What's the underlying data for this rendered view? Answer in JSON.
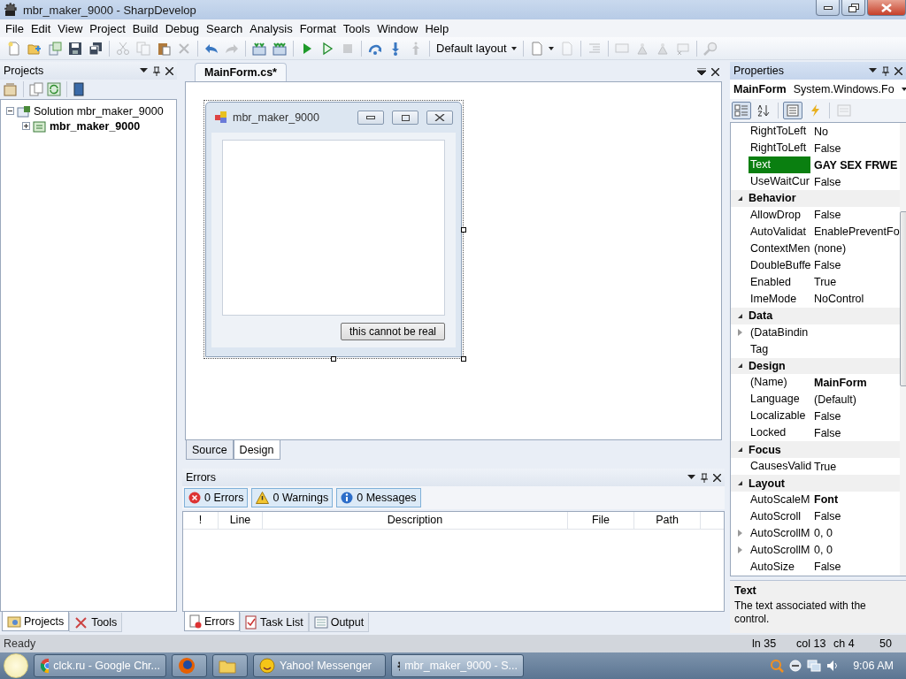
{
  "window": {
    "title": "mbr_maker_9000 - SharpDevelop"
  },
  "menu": [
    "File",
    "Edit",
    "View",
    "Project",
    "Build",
    "Debug",
    "Search",
    "Analysis",
    "Format",
    "Tools",
    "Window",
    "Help"
  ],
  "toolbar": {
    "items": [
      {
        "kind": "new",
        "disabled": false
      },
      {
        "kind": "open",
        "disabled": false
      },
      {
        "kind": "files",
        "disabled": false
      },
      {
        "kind": "save",
        "disabled": false
      },
      {
        "kind": "saveall",
        "disabled": false
      },
      {
        "kind": "sep"
      },
      {
        "kind": "cut",
        "disabled": true
      },
      {
        "kind": "copy",
        "disabled": true
      },
      {
        "kind": "paste",
        "disabled": false
      },
      {
        "kind": "delete",
        "disabled": true
      },
      {
        "kind": "sep"
      },
      {
        "kind": "undo",
        "disabled": false
      },
      {
        "kind": "redo",
        "disabled": true
      },
      {
        "kind": "sep"
      },
      {
        "kind": "build",
        "disabled": false
      },
      {
        "kind": "rebuild",
        "disabled": false
      },
      {
        "kind": "sep"
      },
      {
        "kind": "run",
        "disabled": false
      },
      {
        "kind": "runnodebug",
        "disabled": false
      },
      {
        "kind": "stop",
        "disabled": true
      },
      {
        "kind": "sep"
      },
      {
        "kind": "stepover",
        "disabled": false
      },
      {
        "kind": "stepinto",
        "disabled": false
      },
      {
        "kind": "stepout",
        "disabled": true
      },
      {
        "kind": "sep"
      },
      {
        "kind": "layout",
        "disabled": false
      },
      {
        "kind": "sep"
      },
      {
        "kind": "docmenu",
        "disabled": false
      },
      {
        "kind": "doc",
        "disabled": true
      },
      {
        "kind": "sep"
      },
      {
        "kind": "indent",
        "disabled": true
      },
      {
        "kind": "sep"
      },
      {
        "kind": "comment",
        "disabled": true
      },
      {
        "kind": "bookmark",
        "disabled": true
      },
      {
        "kind": "bookmark",
        "disabled": true
      },
      {
        "kind": "bookmarkdel",
        "disabled": true
      },
      {
        "kind": "sep"
      },
      {
        "kind": "search",
        "disabled": true
      }
    ],
    "layout_value": "Default layout"
  },
  "projects": {
    "title": "Projects",
    "tree": [
      {
        "label": "Solution mbr_maker_9000",
        "expanded": true,
        "startup": false,
        "children": [
          {
            "label": "mbr_maker_9000",
            "expanded": false,
            "startup": true
          }
        ]
      }
    ],
    "tabs": [
      {
        "label": "Projects",
        "kind": "projects",
        "selected": true
      },
      {
        "label": "Tools",
        "kind": "tools",
        "selected": false
      }
    ]
  },
  "document": {
    "tabs": [
      {
        "label": "MainForm.cs*",
        "selected": true
      }
    ],
    "form": {
      "title": "mbr_maker_9000",
      "button": "this cannot be real"
    },
    "view_tabs": [
      {
        "label": "Source",
        "selected": false
      },
      {
        "label": "Design",
        "selected": true
      }
    ]
  },
  "errors": {
    "title": "Errors",
    "filters": [
      {
        "kind": "error",
        "label": "0 Errors",
        "on": true
      },
      {
        "kind": "warning",
        "label": "0 Warnings",
        "on": true
      },
      {
        "kind": "message",
        "label": "0 Messages",
        "on": true
      }
    ],
    "columns": [
      "!",
      "Line",
      "Description",
      "File",
      "Path"
    ],
    "tabs": [
      {
        "label": "Errors",
        "kind": "errors",
        "selected": true
      },
      {
        "label": "Task List",
        "kind": "tasks",
        "selected": false
      },
      {
        "label": "Output",
        "kind": "output",
        "selected": false
      }
    ]
  },
  "properties": {
    "title": "Properties",
    "object": {
      "name": "MainForm",
      "type": "System.Windows.Fo"
    },
    "tools": [
      {
        "kind": "categorized",
        "selected": true,
        "disabled": false
      },
      {
        "kind": "alphabetical",
        "selected": false,
        "disabled": false
      },
      {
        "kind": "sep"
      },
      {
        "kind": "props",
        "selected": true,
        "disabled": false
      },
      {
        "kind": "events",
        "selected": false,
        "disabled": false
      },
      {
        "kind": "sep"
      },
      {
        "kind": "pages",
        "selected": false,
        "disabled": true
      }
    ],
    "rows": [
      {
        "kind": "property",
        "name": "RightToLeft",
        "value": "No",
        "bold": false,
        "expandable": false,
        "selected": false
      },
      {
        "kind": "property",
        "name": "RightToLeft",
        "value": "False",
        "bold": false,
        "expandable": false,
        "selected": false
      },
      {
        "kind": "property",
        "name": "Text",
        "value": "GAY SEX FRWE",
        "bold": true,
        "expandable": false,
        "selected": true
      },
      {
        "kind": "property",
        "name": "UseWaitCur",
        "value": "False",
        "bold": false,
        "expandable": false,
        "selected": false
      },
      {
        "kind": "category",
        "name": "Behavior",
        "expanded": true
      },
      {
        "kind": "property",
        "name": "AllowDrop",
        "value": "False",
        "bold": false,
        "expandable": false,
        "selected": false
      },
      {
        "kind": "property",
        "name": "AutoValidat",
        "value": "EnablePreventFo",
        "bold": false,
        "expandable": false,
        "selected": false
      },
      {
        "kind": "property",
        "name": "ContextMen",
        "value": "(none)",
        "bold": false,
        "expandable": false,
        "selected": false
      },
      {
        "kind": "property",
        "name": "DoubleBuffe",
        "value": "False",
        "bold": false,
        "expandable": false,
        "selected": false
      },
      {
        "kind": "property",
        "name": "Enabled",
        "value": "True",
        "bold": false,
        "expandable": false,
        "selected": false
      },
      {
        "kind": "property",
        "name": "ImeMode",
        "value": "NoControl",
        "bold": false,
        "expandable": false,
        "selected": false
      },
      {
        "kind": "category",
        "name": "Data",
        "expanded": true
      },
      {
        "kind": "property",
        "name": "(DataBindin",
        "expandable": true,
        "selected": false
      },
      {
        "kind": "property",
        "name": "Tag",
        "expandable": false,
        "selected": false
      },
      {
        "kind": "category",
        "name": "Design",
        "expanded": true
      },
      {
        "kind": "property",
        "name": "(Name)",
        "value": "MainForm",
        "bold": true,
        "expandable": false,
        "selected": false
      },
      {
        "kind": "property",
        "name": "Language",
        "value": "(Default)",
        "bold": false,
        "expandable": false,
        "selected": false
      },
      {
        "kind": "property",
        "name": "Localizable",
        "value": "False",
        "bold": false,
        "expandable": false,
        "selected": false
      },
      {
        "kind": "property",
        "name": "Locked",
        "value": "False",
        "bold": false,
        "expandable": false,
        "selected": false
      },
      {
        "kind": "category",
        "name": "Focus",
        "expanded": true
      },
      {
        "kind": "property",
        "name": "CausesValid",
        "value": "True",
        "bold": false,
        "expandable": false,
        "selected": false
      },
      {
        "kind": "category",
        "name": "Layout",
        "expanded": true
      },
      {
        "kind": "property",
        "name": "AutoScaleM",
        "value": "Font",
        "bold": true,
        "expandable": false,
        "selected": false
      },
      {
        "kind": "property",
        "name": "AutoScroll",
        "value": "False",
        "bold": false,
        "expandable": false,
        "selected": false
      },
      {
        "kind": "property",
        "name": "AutoScrollM",
        "value": "0, 0",
        "bold": false,
        "expandable": true,
        "selected": false
      },
      {
        "kind": "property",
        "name": "AutoScrollM",
        "value": "0, 0",
        "bold": false,
        "expandable": true,
        "selected": false
      },
      {
        "kind": "property",
        "name": "AutoSize",
        "value": "False",
        "bold": false,
        "expandable": false,
        "selected": false
      }
    ],
    "description": {
      "title": "Text",
      "text": "The text associated with the control."
    }
  },
  "status": {
    "message": "Ready",
    "fields": [
      "ln 35",
      "col 13",
      "ch 4",
      "50"
    ]
  },
  "taskbar": {
    "items": [
      {
        "kind": "chrome",
        "label": "clck.ru - Google Chr...",
        "active": false
      },
      {
        "kind": "firefox",
        "active": false
      },
      {
        "kind": "folder",
        "active": false
      },
      {
        "kind": "yahoo",
        "label": "Yahoo! Messenger",
        "active": false
      },
      {
        "kind": "sharpdevelop",
        "label": "mbr_maker_9000 - S...",
        "active": true
      }
    ],
    "clock": "9:06 AM"
  }
}
